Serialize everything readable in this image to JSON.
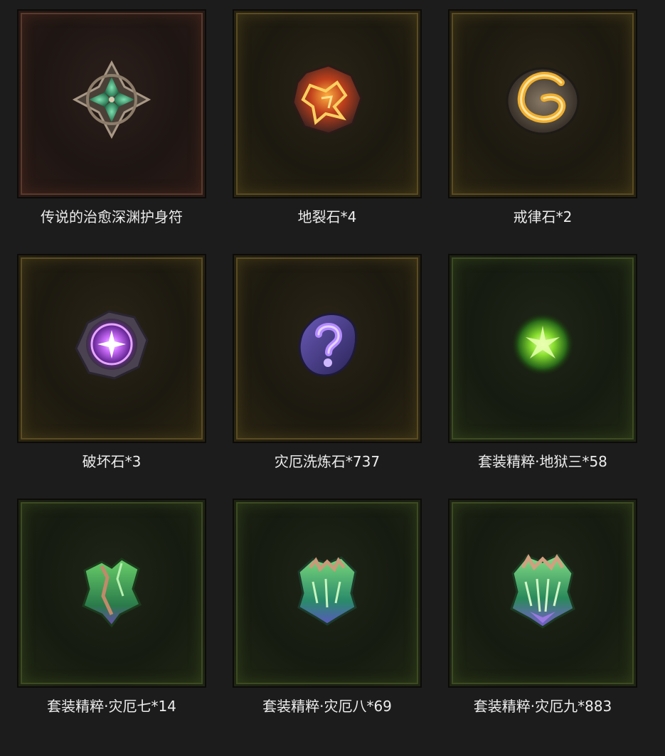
{
  "items": [
    {
      "label": "传说的治愈深渊护身符",
      "quality": "red",
      "icon": "amulet-icon"
    },
    {
      "label": "地裂石*4",
      "quality": "gold",
      "icon": "lava-stone-icon"
    },
    {
      "label": "戒律石*2",
      "quality": "gold",
      "icon": "discipline-stone-icon"
    },
    {
      "label": "破坏石*3",
      "quality": "gold",
      "icon": "destruction-stone-icon"
    },
    {
      "label": "灾厄洗炼石*737",
      "quality": "gold",
      "icon": "reroll-stone-icon"
    },
    {
      "label": "套装精粹·地狱三*58",
      "quality": "green",
      "icon": "green-essence-icon"
    },
    {
      "label": "套装精粹·灾厄七*14",
      "quality": "green",
      "icon": "set-essence-shard-icon"
    },
    {
      "label": "套装精粹·灾厄八*69",
      "quality": "green",
      "icon": "set-essence-crystal-icon"
    },
    {
      "label": "套装精粹·灾厄九*883",
      "quality": "green",
      "icon": "set-essence-crystal-large-icon"
    }
  ],
  "colors": {
    "background": "#1c1c1c",
    "quality_red": "#5a3a2c",
    "quality_gold": "#5a4b22",
    "quality_green": "#3d4a22"
  }
}
